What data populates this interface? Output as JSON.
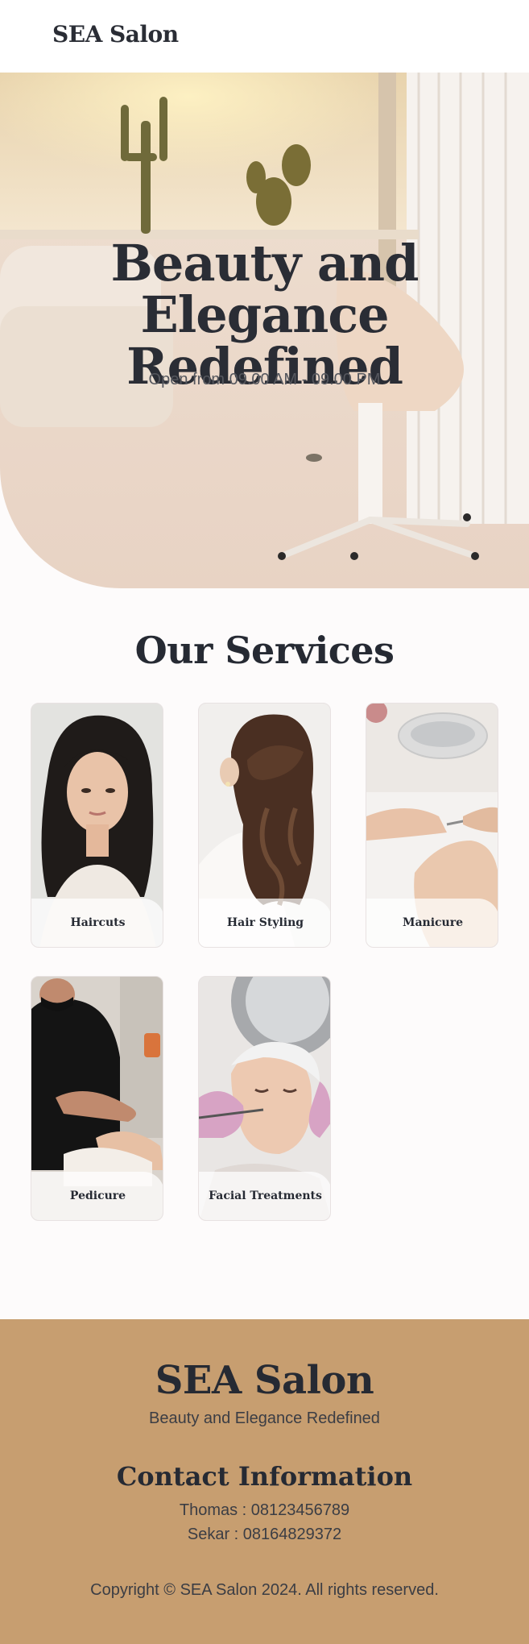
{
  "navbar": {
    "brand": "SEA Salon"
  },
  "hero": {
    "title_line1": "Beauty and",
    "title_line2": "Elegance Redefined",
    "subtitle": "Open from 09.00 AM - 09.00 PM"
  },
  "services": {
    "title": "Our Services",
    "items": [
      {
        "label": "Haircuts"
      },
      {
        "label": "Hair Styling"
      },
      {
        "label": "Manicure"
      },
      {
        "label": "Pedicure"
      },
      {
        "label": "Facial Treatments"
      }
    ]
  },
  "footer": {
    "brand": "SEA Salon",
    "tagline": "Beauty and Elegance Redefined",
    "contact_title": "Contact Information",
    "contacts": [
      {
        "text": "Thomas : 08123456789"
      },
      {
        "text": "Sekar : 08164829372"
      }
    ],
    "copyright": "Copyright © SEA Salon 2024. All rights reserved."
  },
  "colors": {
    "footer_bg": "#c79e70",
    "text_dark": "#262a33",
    "page_bg": "#fdfbfb"
  }
}
